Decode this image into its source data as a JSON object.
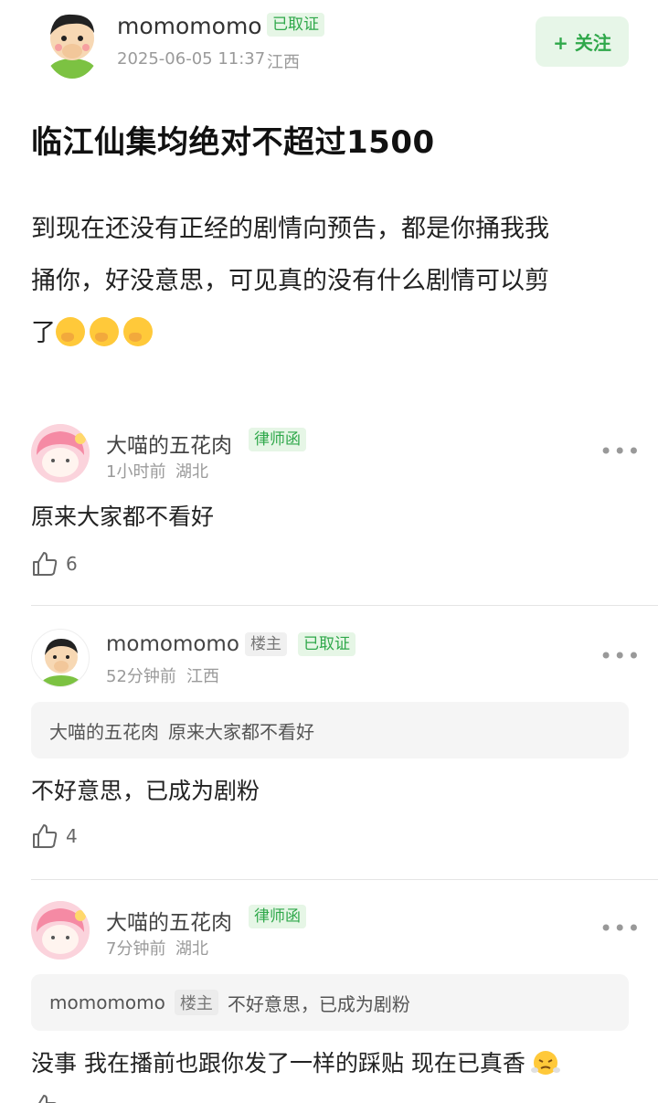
{
  "post": {
    "author": "momomomo",
    "badge": "已取证",
    "date": "2025-06-05 11:37",
    "location": "江西",
    "follow": "+ 关注",
    "title": "临江仙集均绝对不超过1500",
    "body_line1": "到现在还没有正经的剧情向预告，都是你捅我我",
    "body_line2": "捅你，好没意思，可见真的没有什么剧情可以剪",
    "body_line3": "了"
  },
  "comments": [
    {
      "author": "大喵的五花肉",
      "badge": "律师函",
      "time": "1小时前",
      "location": "湖北",
      "text": "原来大家都不看好",
      "likes": "6"
    },
    {
      "author": "momomomo",
      "op": "楼主",
      "badge": "已取证",
      "time": "52分钟前",
      "location": "江西",
      "quote_author": "大喵的五花肉",
      "quote_text": "原来大家都不看好",
      "text": "不好意思，已成为剧粉",
      "likes": "4"
    },
    {
      "author": "大喵的五花肉",
      "badge": "律师函",
      "time": "7分钟前",
      "location": "湖北",
      "quote_author": "momomomo",
      "quote_op": "楼主",
      "quote_text": "不好意思，已成为剧粉",
      "text": "没事 我在播前也跟你发了一样的踩贴 现在已真香"
    }
  ],
  "icons": {
    "more": "more-dots-icon",
    "like": "thumbs-up-icon",
    "emoji": "face-with-hand-over-mouth-emoji",
    "emoji_last": "face-with-steam-emoji"
  },
  "colors": {
    "accent_green": "#2fa84a",
    "badge_bg": "#e6f6e6"
  }
}
